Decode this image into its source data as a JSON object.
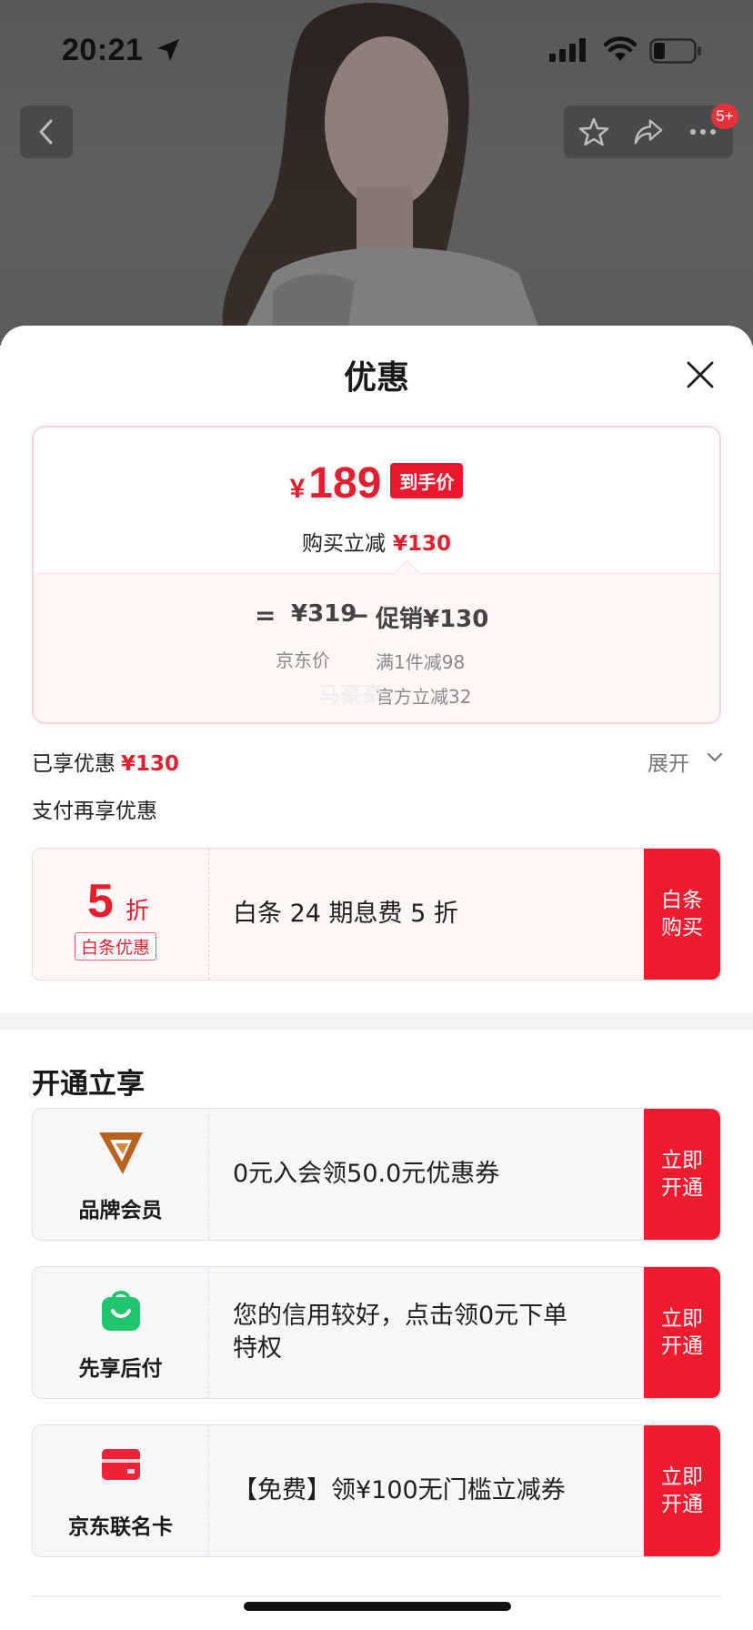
{
  "status_bar": {
    "time": "20:21"
  },
  "header": {
    "more_badge": "5+"
  },
  "sheet": {
    "title": "优惠",
    "price_card": {
      "currency": "¥",
      "final_price": "189",
      "final_tag": "到手价",
      "reduce_label": "购买立减",
      "reduce_amount": "¥130",
      "equals": "=",
      "base_price": "¥319",
      "base_label": "京东价",
      "minus": "−",
      "promo": "促销¥130",
      "promo_detail_1": "满1件减98",
      "promo_detail_2": "官方立减32"
    },
    "enjoyed_label": "已享优惠",
    "enjoyed_amount": "¥130",
    "expand_label": "展开",
    "watermark": "马豪豪",
    "pay_more_label": "支付再享优惠",
    "baitiao_offer": {
      "discount_number": "5",
      "discount_unit": "折",
      "discount_tag": "白条优惠",
      "text": "白条 24 期息费 5 折",
      "button": "白条购买"
    },
    "open_section_title": "开通立享",
    "services": [
      {
        "icon": "brand-member-v-icon",
        "label": "品牌会员",
        "text": "0元入会领50.0元优惠券",
        "button": "立即开通"
      },
      {
        "icon": "shopping-bag-smile-icon",
        "label": "先享后付",
        "text": "您的信用较好，点击领0元下单特权",
        "button": "立即开通"
      },
      {
        "icon": "credit-card-icon",
        "label": "京东联名卡",
        "text": "【免费】领¥100无门槛立减券",
        "button": "立即开通"
      }
    ]
  },
  "colors": {
    "accent_red": "#e41e2f",
    "button_red": "#f11a2f",
    "member_gold": "#b8621e",
    "pay_green": "#1fc46d",
    "card_red": "#ee2338"
  }
}
